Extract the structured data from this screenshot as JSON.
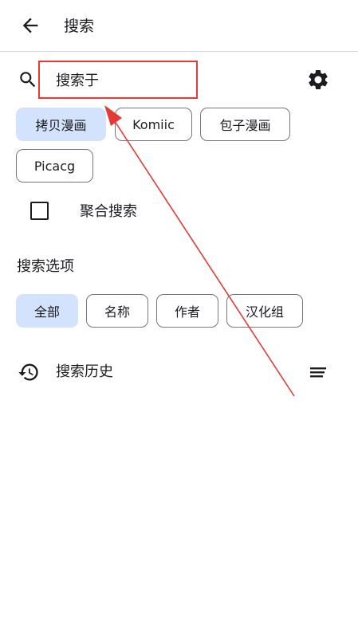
{
  "appbar": {
    "title": "搜索",
    "back_icon": "arrow-back-icon"
  },
  "search": {
    "value": "搜索于",
    "search_icon": "search-icon",
    "settings_icon": "gear-icon"
  },
  "sources": [
    {
      "label": "拷贝漫画",
      "selected": true
    },
    {
      "label": "Komiic",
      "selected": false
    },
    {
      "label": "包子漫画",
      "selected": false
    },
    {
      "label": "Picacg",
      "selected": false
    }
  ],
  "aggregate": {
    "label": "聚合搜索",
    "checked": false
  },
  "options": {
    "title": "搜索选项",
    "chips": [
      {
        "label": "全部",
        "selected": true
      },
      {
        "label": "名称",
        "selected": false
      },
      {
        "label": "作者",
        "selected": false
      },
      {
        "label": "汉化组",
        "selected": false
      }
    ]
  },
  "history": {
    "label": "搜索历史",
    "history_icon": "history-icon",
    "clear_icon": "clear-all-icon"
  },
  "colors": {
    "selected_chip": "#d3e3fd",
    "annotation_red": "#e53935",
    "chip_border": "#79747e"
  }
}
